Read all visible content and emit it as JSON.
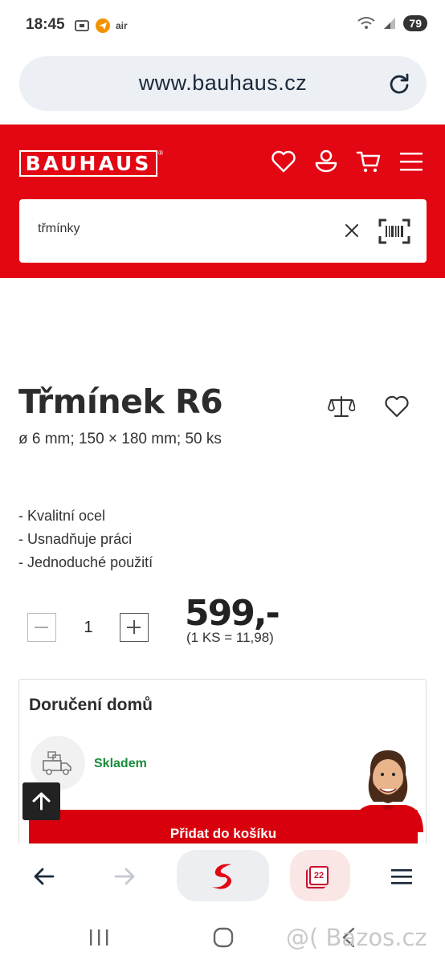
{
  "status_bar": {
    "time": "18:45",
    "network_label": "air",
    "battery": "79"
  },
  "browser": {
    "url": "www.bauhaus.cz",
    "tab_count": "22"
  },
  "header": {
    "logo_text": "BAUHAUS",
    "logo_reg": "®",
    "brand_color": "#e30613",
    "search_value": "třmínky"
  },
  "product": {
    "title": "Třmínek R6",
    "subtitle": "ø 6 mm; 150 × 180 mm; 50 ks",
    "features": [
      "- Kvalitní ocel",
      "- Usnadňuje práci",
      "- Jednoduché použití"
    ],
    "quantity": "1",
    "price": "599,-",
    "unit_price": "(1 KS = 11,98)"
  },
  "delivery": {
    "title": "Doručení domů",
    "stock_status": "Skladem",
    "stock_color": "#1a8b3a",
    "add_to_cart_label": "Přidat do košíku"
  },
  "watermark": "@( Bazos.cz"
}
